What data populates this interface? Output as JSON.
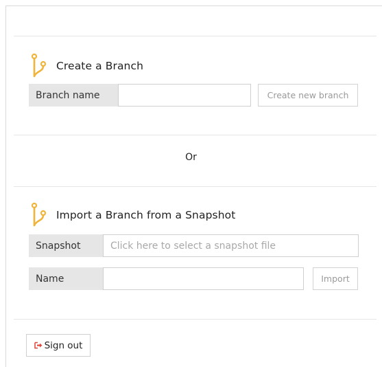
{
  "create": {
    "title": "Create a Branch",
    "branch_label": "Branch name",
    "branch_value": "",
    "button": "Create new branch"
  },
  "divider_text": "Or",
  "import": {
    "title": "Import a Branch from a Snapshot",
    "snapshot_label": "Snapshot",
    "snapshot_placeholder": "Click here to select a snapshot file",
    "name_label": "Name",
    "name_value": "",
    "button": "Import"
  },
  "signout": {
    "label": "Sign out",
    "icon": "sign-out-icon"
  },
  "colors": {
    "branch_icon": "#f0b43a",
    "signout_icon": "#e0443a",
    "label_bg": "#e6e6e6"
  },
  "icons": {
    "section": "git-branch-icon"
  }
}
